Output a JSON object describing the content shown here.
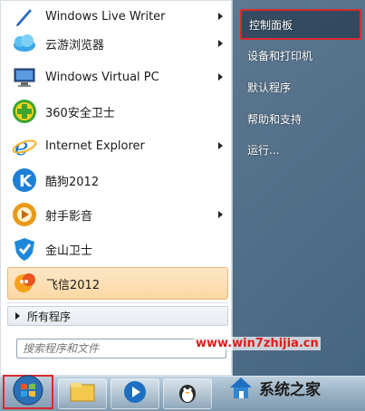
{
  "programs": [
    {
      "label": "Windows Live Writer",
      "icon": "windows-live-writer-icon",
      "has_submenu": true
    },
    {
      "label": "云游浏览器",
      "icon": "yunyou-browser-icon",
      "has_submenu": true
    },
    {
      "label": "Windows Virtual PC",
      "icon": "windows-virtual-pc-icon",
      "has_submenu": true
    },
    {
      "label": "360安全卫士",
      "icon": "360-security-icon",
      "has_submenu": false
    },
    {
      "label": "Internet Explorer",
      "icon": "internet-explorer-icon",
      "has_submenu": true
    },
    {
      "label": "酷狗2012",
      "icon": "kugou-icon",
      "has_submenu": false
    },
    {
      "label": "射手影音",
      "icon": "shooter-player-icon",
      "has_submenu": true
    },
    {
      "label": "金山卫士",
      "icon": "kingsoft-guard-icon",
      "has_submenu": false
    },
    {
      "label": "飞信2012",
      "icon": "fetion-icon",
      "has_submenu": false
    }
  ],
  "all_programs_label": "所有程序",
  "search_placeholder": "搜索程序和文件",
  "right_items": [
    {
      "label": "控制面板",
      "selected": true
    },
    {
      "label": "设备和打印机",
      "selected": false
    },
    {
      "label": "默认程序",
      "selected": false
    },
    {
      "label": "帮助和支持",
      "selected": false
    },
    {
      "label": "运行...",
      "selected": false
    }
  ],
  "watermark": "www.win7zhijia.cn",
  "brand": "系统之家",
  "taskbar_items": [
    "start-orb-icon",
    "file-explorer-icon",
    "media-player-icon",
    "qq-penguin-icon"
  ],
  "colors": {
    "highlight": "#d62b2b",
    "watermark": "#e01b1b"
  }
}
